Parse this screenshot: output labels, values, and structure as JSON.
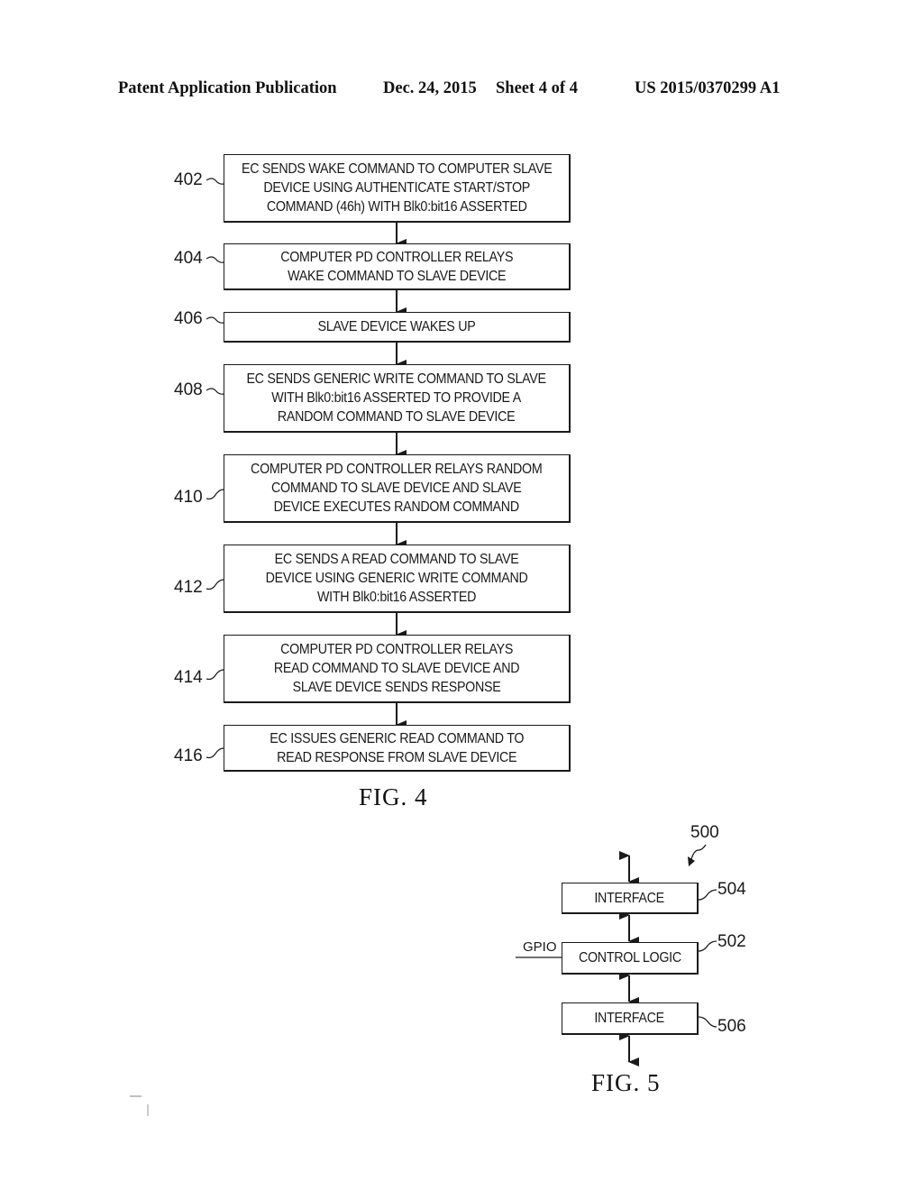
{
  "header": {
    "publication": "Patent Application Publication",
    "date": "Dec. 24, 2015",
    "sheet": "Sheet 4 of 4",
    "number": "US 2015/0370299 A1"
  },
  "fig4": {
    "caption": "FIG. 4",
    "steps": [
      {
        "ref": "402",
        "text": "EC SENDS WAKE COMMAND TO COMPUTER SLAVE\nDEVICE USING AUTHENTICATE START/STOP\nCOMMAND (46h) WITH Blk0:bit16 ASSERTED"
      },
      {
        "ref": "404",
        "text": "COMPUTER PD CONTROLLER RELAYS\nWAKE COMMAND TO SLAVE DEVICE"
      },
      {
        "ref": "406",
        "text": "SLAVE DEVICE WAKES UP"
      },
      {
        "ref": "408",
        "text": "EC SENDS GENERIC WRITE COMMAND TO SLAVE\nWITH Blk0:bit16 ASSERTED TO PROVIDE A\nRANDOM COMMAND TO SLAVE DEVICE"
      },
      {
        "ref": "410",
        "text": "COMPUTER PD CONTROLLER RELAYS RANDOM\nCOMMAND TO SLAVE DEVICE AND SLAVE\nDEVICE EXECUTES RANDOM COMMAND"
      },
      {
        "ref": "412",
        "text": "EC SENDS A READ COMMAND TO SLAVE\nDEVICE USING GENERIC WRITE COMMAND\nWITH Blk0:bit16 ASSERTED"
      },
      {
        "ref": "414",
        "text": "COMPUTER PD CONTROLLER RELAYS\nREAD COMMAND TO SLAVE DEVICE AND\nSLAVE DEVICE SENDS RESPONSE"
      },
      {
        "ref": "416",
        "text": "EC ISSUES GENERIC READ COMMAND TO\nREAD RESPONSE FROM SLAVE DEVICE"
      }
    ]
  },
  "fig5": {
    "caption": "FIG. 5",
    "system_ref": "500",
    "gpio_label": "GPIO",
    "blocks": [
      {
        "ref": "504",
        "text": "INTERFACE"
      },
      {
        "ref": "502",
        "text": "CONTROL LOGIC"
      },
      {
        "ref": "506",
        "text": "INTERFACE"
      }
    ]
  }
}
